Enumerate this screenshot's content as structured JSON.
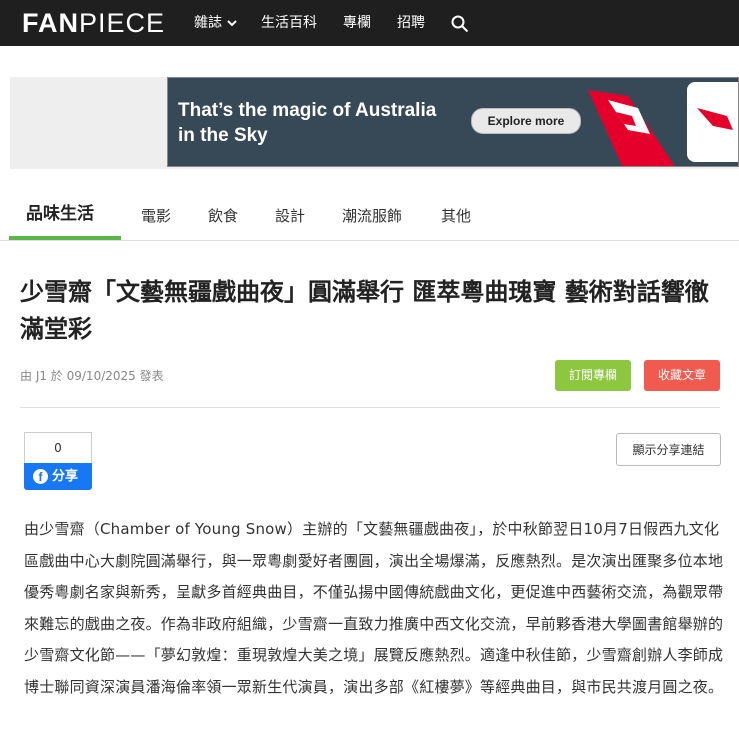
{
  "header": {
    "logo_bold": "FAN",
    "logo_light": "PIECE",
    "nav": [
      "雜誌",
      "生活百科",
      "專欄",
      "招聘"
    ]
  },
  "ad": {
    "text_line1": "That’s the magic of Australia",
    "text_line2": "in the Sky",
    "button": "Explore more",
    "colors": {
      "background": "#374957",
      "accent": "#e4002b"
    }
  },
  "tabs": [
    "品味生活",
    "電影",
    "飲食",
    "設計",
    "潮流服飾",
    "其他"
  ],
  "article": {
    "title": "少雪齋「文藝無疆戲曲夜」圓滿舉行 匯萃粵曲瑰寶 藝術對話響徹滿堂彩",
    "meta": "由 J1 於 09/10/2025 發表",
    "subscribe_label": "訂閱專欄",
    "favorite_label": "收藏文章",
    "fb_count": "0",
    "fb_share_label": "分享",
    "show_share_link_label": "顯示分享連結",
    "body": "由少雪齋（Chamber of Young Snow）主辦的「文藝無疆戲曲夜」，於中秋節翌日10月7日假西九文化區戲曲中心大劇院圓滿舉行，與一眾粵劇愛好者團圓，演出全場爆滿，反應熱烈。是次演出匯聚多位本地優秀粵劇名家與新秀，呈獻多首經典曲目，不僅弘揚中國傳統戲曲文化，更促進中西藝術交流，為觀眾帶來難忘的戲曲之夜。作為非政府組織，少雪齋一直致力推廣中西文化交流，早前夥香港大學圖書館舉辦的少雪齋文化節——「夢幻敦煌：重現敦煌大美之境」展覽反應熱烈。適逢中秋佳節，少雪齋創辦人李師成博士聯同資深演員潘海倫率領一眾新生代演員，演出多部《紅樓夢》等經典曲目，與市民共渡月圓之夜。"
  },
  "colors": {
    "accent_green": "#8dc63f",
    "tab_underline": "#5bb54a",
    "favorite_red": "#f05a4f",
    "facebook_blue": "#1877f2"
  }
}
